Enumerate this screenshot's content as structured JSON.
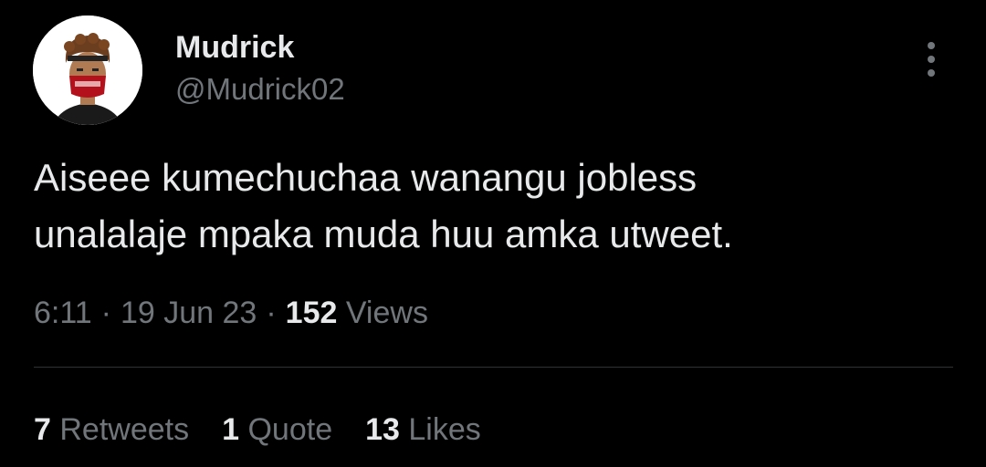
{
  "tweet": {
    "author": {
      "display_name": "Mudrick",
      "handle": "@Mudrick02",
      "avatar_icon": "profile-avatar-icon"
    },
    "more_icon": "more-vertical-icon",
    "text_lines": [
      "Aiseee kumechuchaa wanangu jobless",
      "unalalaje mpaka muda huu amka utweet."
    ],
    "time": "6:11",
    "date": "19 Jun 23",
    "separator": "·",
    "views_count": "152",
    "views_label": "Views"
  },
  "stats": {
    "retweets_count": "7",
    "retweets_label": "Retweets",
    "quotes_count": "1",
    "quotes_label": "Quote",
    "likes_count": "13",
    "likes_label": "Likes"
  },
  "colors": {
    "background": "#000000",
    "primary_text": "#e7e9ea",
    "secondary_text": "#71767b",
    "divider": "#2f3336"
  }
}
